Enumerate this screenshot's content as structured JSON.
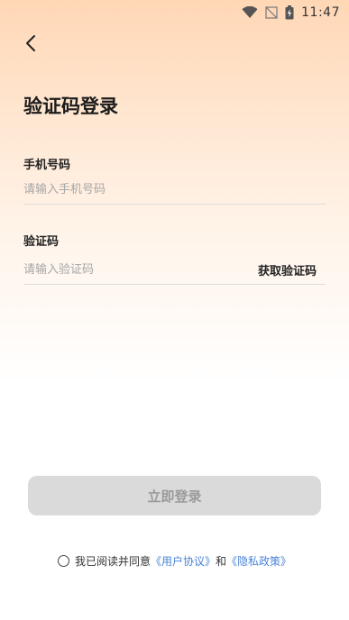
{
  "status_bar": {
    "time": "11:47",
    "icons": [
      "wifi-icon",
      "no-signal-icon",
      "battery-charging-icon"
    ]
  },
  "header": {
    "back_icon": "chevron-left-icon"
  },
  "title": "验证码登录",
  "phone": {
    "label": "手机号码",
    "placeholder": "请输入手机号码",
    "value": ""
  },
  "code": {
    "label": "验证码",
    "placeholder": "请输入验证码",
    "value": "",
    "get_code_label": "获取验证码"
  },
  "login_button": {
    "label": "立即登录",
    "enabled": false
  },
  "agreement": {
    "checked": false,
    "text": "我已阅读并同意",
    "user_agreement": "《用户协议》",
    "and": "和",
    "privacy_policy": "《隐私政策》"
  },
  "colors": {
    "link": "#4a84d8",
    "button_disabled_bg": "#dadada",
    "button_disabled_text": "#9a9a9a"
  }
}
